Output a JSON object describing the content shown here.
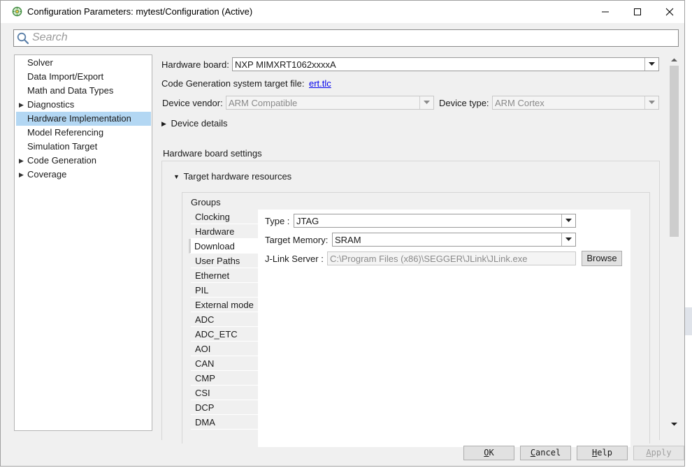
{
  "window": {
    "title": "Configuration Parameters: mytest/Configuration (Active)"
  },
  "search": {
    "placeholder": "Search"
  },
  "tree": {
    "items": [
      {
        "label": "Solver",
        "expandable": false,
        "selected": false
      },
      {
        "label": "Data Import/Export",
        "expandable": false,
        "selected": false
      },
      {
        "label": "Math and Data Types",
        "expandable": false,
        "selected": false
      },
      {
        "label": "Diagnostics",
        "expandable": true,
        "selected": false
      },
      {
        "label": "Hardware Implementation",
        "expandable": false,
        "selected": true
      },
      {
        "label": "Model Referencing",
        "expandable": false,
        "selected": false
      },
      {
        "label": "Simulation Target",
        "expandable": false,
        "selected": false
      },
      {
        "label": "Code Generation",
        "expandable": true,
        "selected": false
      },
      {
        "label": "Coverage",
        "expandable": true,
        "selected": false
      }
    ]
  },
  "hardware": {
    "board_label": "Hardware board:",
    "board_value": "NXP MIMXRT1062xxxxA",
    "target_file_label": "Code Generation system target file:",
    "target_file_link": "ert.tlc",
    "vendor_label": "Device vendor:",
    "vendor_value": "ARM Compatible",
    "type_label": "Device type:",
    "type_value": "ARM Cortex",
    "device_details": "Device details",
    "board_settings": "Hardware board settings",
    "target_resources": "Target hardware resources",
    "groups_label": "Groups",
    "groups": [
      "Clocking",
      "Hardware",
      "Download",
      "User Paths",
      "Ethernet",
      "PIL",
      "External mode",
      "ADC",
      "ADC_ETC",
      "AOI",
      "CAN",
      "CMP",
      "CSI",
      "DCP",
      "DMA"
    ],
    "active_group": "Download",
    "download": {
      "type_label": "Type :",
      "type_value": "JTAG",
      "memory_label": "Target Memory:",
      "memory_value": "SRAM",
      "jlink_label": "J-Link Server :",
      "jlink_value": "C:\\Program Files (x86)\\SEGGER\\JLink\\JLink.exe",
      "browse_label": "Browse"
    }
  },
  "footer": {
    "ok": {
      "mnemonic": "O",
      "rest": "K"
    },
    "cancel": {
      "mnemonic": "C",
      "rest": "ancel"
    },
    "help": {
      "mnemonic": "H",
      "rest": "elp"
    },
    "apply": {
      "mnemonic": "A",
      "rest": "pply"
    }
  },
  "colors": {
    "selection": "#b3d7f3",
    "link": "#0000ee",
    "window_bg": "#f0f0f0"
  }
}
